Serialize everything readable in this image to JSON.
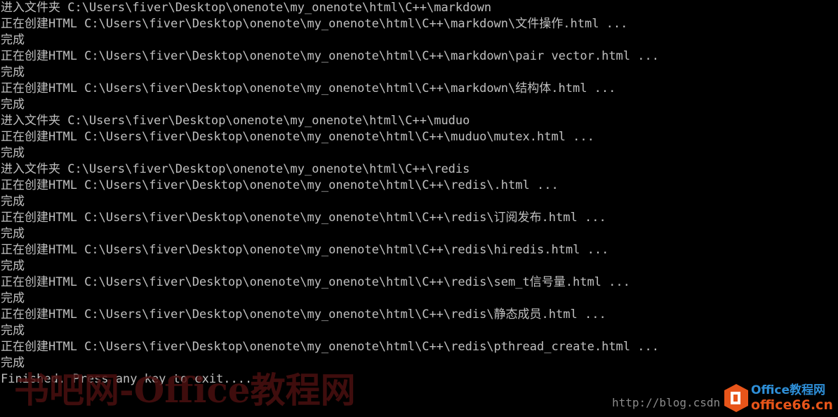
{
  "console": {
    "lines": [
      "进入文件夹 C:\\Users\\fiver\\Desktop\\onenote\\my_onenote\\html\\C++\\markdown",
      "正在创建HTML C:\\Users\\fiver\\Desktop\\onenote\\my_onenote\\html\\C++\\markdown\\文件操作.html ...",
      "完成",
      "正在创建HTML C:\\Users\\fiver\\Desktop\\onenote\\my_onenote\\html\\C++\\markdown\\pair vector.html ...",
      "完成",
      "正在创建HTML C:\\Users\\fiver\\Desktop\\onenote\\my_onenote\\html\\C++\\markdown\\结构体.html ...",
      "完成",
      "进入文件夹 C:\\Users\\fiver\\Desktop\\onenote\\my_onenote\\html\\C++\\muduo",
      "正在创建HTML C:\\Users\\fiver\\Desktop\\onenote\\my_onenote\\html\\C++\\muduo\\mutex.html ...",
      "完成",
      "进入文件夹 C:\\Users\\fiver\\Desktop\\onenote\\my_onenote\\html\\C++\\redis",
      "正在创建HTML C:\\Users\\fiver\\Desktop\\onenote\\my_onenote\\html\\C++\\redis\\.html ...",
      "完成",
      "正在创建HTML C:\\Users\\fiver\\Desktop\\onenote\\my_onenote\\html\\C++\\redis\\订阅发布.html ...",
      "完成",
      "正在创建HTML C:\\Users\\fiver\\Desktop\\onenote\\my_onenote\\html\\C++\\redis\\hiredis.html ...",
      "完成",
      "正在创建HTML C:\\Users\\fiver\\Desktop\\onenote\\my_onenote\\html\\C++\\redis\\sem_t信号量.html ...",
      "完成",
      "正在创建HTML C:\\Users\\fiver\\Desktop\\onenote\\my_onenote\\html\\C++\\redis\\静态成员.html ...",
      "完成",
      "正在创建HTML C:\\Users\\fiver\\Desktop\\onenote\\my_onenote\\html\\C++\\redis\\pthread_create.html ...",
      "完成",
      "Finished. Press any key to exit...."
    ]
  },
  "watermark": {
    "site_text": "书吧网-Office教程网",
    "url_text": "http://blog.csdn",
    "logo_top": "Office教程网",
    "logo_bottom": "office66.cn"
  },
  "colors": {
    "background": "#000000",
    "text": "#c0c0c0",
    "logo_orange": "#e8551a",
    "logo_blue": "#2e8fd8"
  }
}
